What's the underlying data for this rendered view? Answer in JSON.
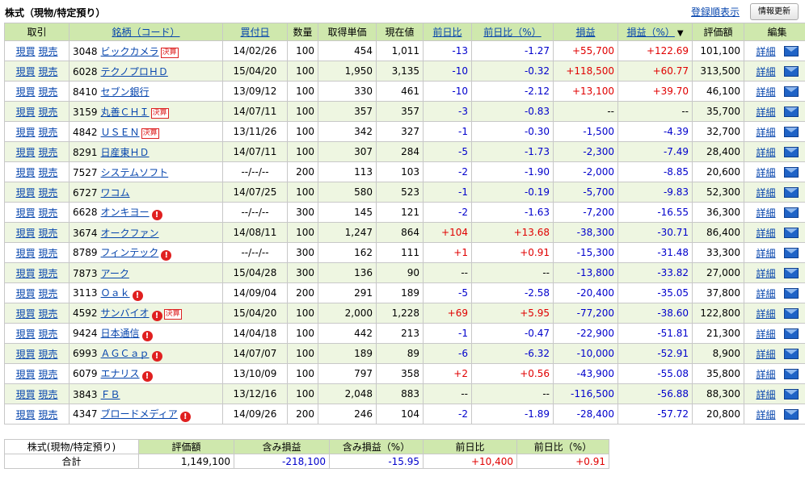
{
  "page": {
    "title": "株式（現物/特定預り）",
    "reg_order_link": "登録順表示",
    "refresh_button": "情報更新"
  },
  "headers": [
    "取引",
    "銘柄（コード）",
    "買付日",
    "数量",
    "取得単価",
    "現在値",
    "前日比",
    "前日比（%）",
    "損益",
    "損益（%）",
    "評価額",
    "編集"
  ],
  "sort_marker": "▼",
  "row_links": {
    "buy": "現買",
    "sell": "現売",
    "detail": "詳細"
  },
  "badges": {
    "kessan": "決算",
    "alert": "!"
  },
  "colors": {
    "header_bg": "#cfe8ad",
    "stripe_bg": "#eef6e1",
    "positive": "#e00000",
    "negative": "#0000cc",
    "link": "#0645ad"
  },
  "rows": [
    {
      "code": "3048",
      "name": "ビックカメラ",
      "kessan": true,
      "alert": false,
      "date": "14/02/26",
      "qty": "100",
      "cost": "454",
      "price": "1,011",
      "chg": "-13",
      "chg_pct": "-1.27",
      "pl": "+55,700",
      "pl_pct": "+122.69",
      "value": "101,100"
    },
    {
      "code": "6028",
      "name": "テクノプロＨＤ",
      "kessan": false,
      "alert": false,
      "date": "15/04/20",
      "qty": "100",
      "cost": "1,950",
      "price": "3,135",
      "chg": "-10",
      "chg_pct": "-0.32",
      "pl": "+118,500",
      "pl_pct": "+60.77",
      "value": "313,500"
    },
    {
      "code": "8410",
      "name": "セブン銀行",
      "kessan": false,
      "alert": false,
      "date": "13/09/12",
      "qty": "100",
      "cost": "330",
      "price": "461",
      "chg": "-10",
      "chg_pct": "-2.12",
      "pl": "+13,100",
      "pl_pct": "+39.70",
      "value": "46,100"
    },
    {
      "code": "3159",
      "name": "丸善ＣＨＩ",
      "kessan": true,
      "alert": false,
      "date": "14/07/11",
      "qty": "100",
      "cost": "357",
      "price": "357",
      "chg": "-3",
      "chg_pct": "-0.83",
      "pl": "--",
      "pl_pct": "--",
      "value": "35,700"
    },
    {
      "code": "4842",
      "name": "ＵＳＥＮ",
      "kessan": true,
      "alert": false,
      "date": "13/11/26",
      "qty": "100",
      "cost": "342",
      "price": "327",
      "chg": "-1",
      "chg_pct": "-0.30",
      "pl": "-1,500",
      "pl_pct": "-4.39",
      "value": "32,700"
    },
    {
      "code": "8291",
      "name": "日産東ＨＤ",
      "kessan": false,
      "alert": false,
      "date": "14/07/11",
      "qty": "100",
      "cost": "307",
      "price": "284",
      "chg": "-5",
      "chg_pct": "-1.73",
      "pl": "-2,300",
      "pl_pct": "-7.49",
      "value": "28,400"
    },
    {
      "code": "7527",
      "name": "システムソフト",
      "kessan": false,
      "alert": false,
      "date": "--/--/--",
      "qty": "200",
      "cost": "113",
      "price": "103",
      "chg": "-2",
      "chg_pct": "-1.90",
      "pl": "-2,000",
      "pl_pct": "-8.85",
      "value": "20,600"
    },
    {
      "code": "6727",
      "name": "ワコム",
      "kessan": false,
      "alert": false,
      "date": "14/07/25",
      "qty": "100",
      "cost": "580",
      "price": "523",
      "chg": "-1",
      "chg_pct": "-0.19",
      "pl": "-5,700",
      "pl_pct": "-9.83",
      "value": "52,300"
    },
    {
      "code": "6628",
      "name": "オンキヨー",
      "kessan": false,
      "alert": true,
      "date": "--/--/--",
      "qty": "300",
      "cost": "145",
      "price": "121",
      "chg": "-2",
      "chg_pct": "-1.63",
      "pl": "-7,200",
      "pl_pct": "-16.55",
      "value": "36,300"
    },
    {
      "code": "3674",
      "name": "オークファン",
      "kessan": false,
      "alert": false,
      "date": "14/08/11",
      "qty": "100",
      "cost": "1,247",
      "price": "864",
      "chg": "+104",
      "chg_pct": "+13.68",
      "pl": "-38,300",
      "pl_pct": "-30.71",
      "value": "86,400"
    },
    {
      "code": "8789",
      "name": "フィンテック",
      "kessan": false,
      "alert": true,
      "date": "--/--/--",
      "qty": "300",
      "cost": "162",
      "price": "111",
      "chg": "+1",
      "chg_pct": "+0.91",
      "pl": "-15,300",
      "pl_pct": "-31.48",
      "value": "33,300"
    },
    {
      "code": "7873",
      "name": "アーク",
      "kessan": false,
      "alert": false,
      "date": "15/04/28",
      "qty": "300",
      "cost": "136",
      "price": "90",
      "chg": "--",
      "chg_pct": "--",
      "pl": "-13,800",
      "pl_pct": "-33.82",
      "value": "27,000"
    },
    {
      "code": "3113",
      "name": "Ｏａｋ",
      "kessan": false,
      "alert": true,
      "date": "14/09/04",
      "qty": "200",
      "cost": "291",
      "price": "189",
      "chg": "-5",
      "chg_pct": "-2.58",
      "pl": "-20,400",
      "pl_pct": "-35.05",
      "value": "37,800"
    },
    {
      "code": "4592",
      "name": "サンバイオ",
      "kessan": true,
      "alert": true,
      "date": "15/04/20",
      "qty": "100",
      "cost": "2,000",
      "price": "1,228",
      "chg": "+69",
      "chg_pct": "+5.95",
      "pl": "-77,200",
      "pl_pct": "-38.60",
      "value": "122,800"
    },
    {
      "code": "9424",
      "name": "日本通信",
      "kessan": false,
      "alert": true,
      "date": "14/04/18",
      "qty": "100",
      "cost": "442",
      "price": "213",
      "chg": "-1",
      "chg_pct": "-0.47",
      "pl": "-22,900",
      "pl_pct": "-51.81",
      "value": "21,300"
    },
    {
      "code": "6993",
      "name": "ＡＧＣａｐ",
      "kessan": false,
      "alert": true,
      "date": "14/07/07",
      "qty": "100",
      "cost": "189",
      "price": "89",
      "chg": "-6",
      "chg_pct": "-6.32",
      "pl": "-10,000",
      "pl_pct": "-52.91",
      "value": "8,900"
    },
    {
      "code": "6079",
      "name": "エナリス",
      "kessan": false,
      "alert": true,
      "date": "13/10/09",
      "qty": "100",
      "cost": "797",
      "price": "358",
      "chg": "+2",
      "chg_pct": "+0.56",
      "pl": "-43,900",
      "pl_pct": "-55.08",
      "value": "35,800"
    },
    {
      "code": "3843",
      "name": "ＦＢ",
      "kessan": false,
      "alert": false,
      "date": "13/12/16",
      "qty": "100",
      "cost": "2,048",
      "price": "883",
      "chg": "--",
      "chg_pct": "--",
      "pl": "-116,500",
      "pl_pct": "-56.88",
      "value": "88,300"
    },
    {
      "code": "4347",
      "name": "ブロードメディア",
      "kessan": false,
      "alert": true,
      "date": "14/09/26",
      "qty": "200",
      "cost": "246",
      "price": "104",
      "chg": "-2",
      "chg_pct": "-1.89",
      "pl": "-28,400",
      "pl_pct": "-57.72",
      "value": "20,800"
    }
  ],
  "summary": {
    "label_line1": "株式(現物/特定預り)",
    "label_line2": "合計",
    "headers": [
      "評価額",
      "含み損益",
      "含み損益（%）",
      "前日比",
      "前日比（%）"
    ],
    "values": [
      "1,149,100",
      "-218,100",
      "-15.95",
      "+10,400",
      "+0.91"
    ]
  }
}
